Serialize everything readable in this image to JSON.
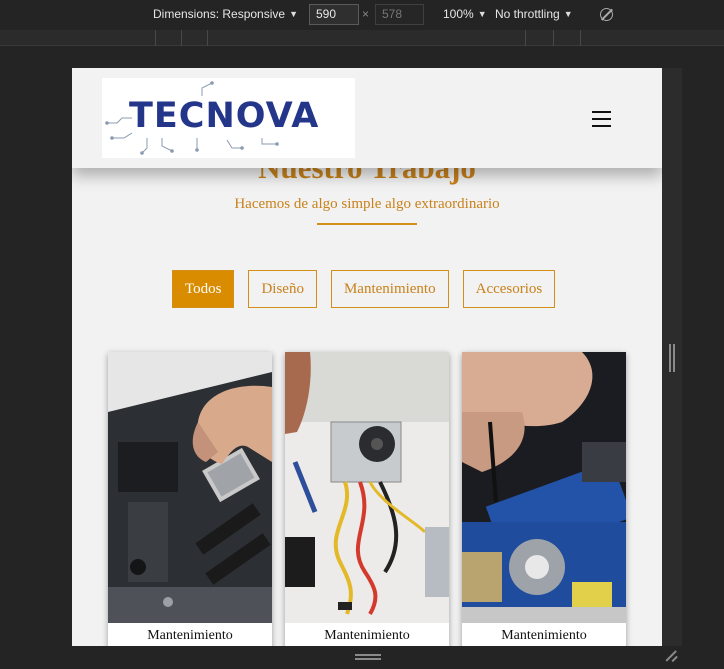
{
  "devtools": {
    "dimensions_label": "Dimensions: Responsive",
    "width": "590",
    "height": "578",
    "times": "×",
    "zoom": "100%",
    "throttling": "No throttling",
    "icons": [
      "caret-down-icon",
      "rotate-icon"
    ]
  },
  "site": {
    "logo_text": "TECNOVA",
    "section_title": "Nuestro Trabajo",
    "subtitle": "Hacemos de algo simple algo extraordinario",
    "filters": [
      {
        "label": "Todos",
        "active": true
      },
      {
        "label": "Diseño",
        "active": false
      },
      {
        "label": "Mantenimiento",
        "active": false
      },
      {
        "label": "Accesorios",
        "active": false
      }
    ],
    "cards": [
      {
        "label": "Mantenimiento"
      },
      {
        "label": "Mantenimiento"
      },
      {
        "label": "Mantenimiento"
      }
    ]
  },
  "colors": {
    "accent": "#d98c00",
    "accent_text": "#c8821b",
    "logo": "#23368a",
    "devtools_bg": "#242424",
    "page_bg": "#f2f2f2"
  }
}
